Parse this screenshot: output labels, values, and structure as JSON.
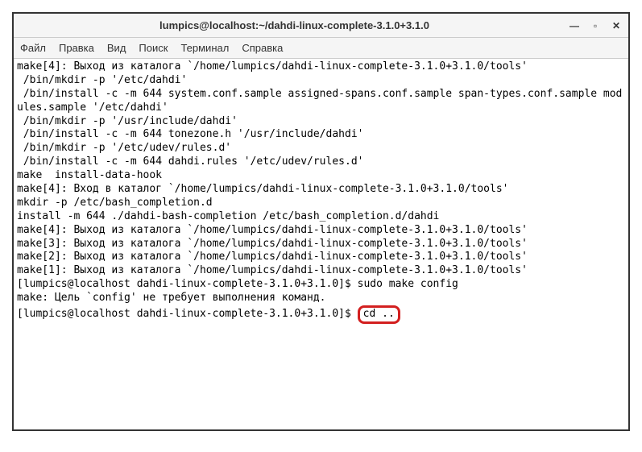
{
  "window": {
    "title": "lumpics@localhost:~/dahdi-linux-complete-3.1.0+3.1.0"
  },
  "menubar": {
    "items": [
      "Файл",
      "Правка",
      "Вид",
      "Поиск",
      "Терминал",
      "Справка"
    ]
  },
  "terminal": {
    "lines": [
      "make[4]: Выход из каталога `/home/lumpics/dahdi-linux-complete-3.1.0+3.1.0/tools'",
      " /bin/mkdir -p '/etc/dahdi'",
      " /bin/install -c -m 644 system.conf.sample assigned-spans.conf.sample span-types.conf.sample modules.sample '/etc/dahdi'",
      " /bin/mkdir -p '/usr/include/dahdi'",
      " /bin/install -c -m 644 tonezone.h '/usr/include/dahdi'",
      " /bin/mkdir -p '/etc/udev/rules.d'",
      " /bin/install -c -m 644 dahdi.rules '/etc/udev/rules.d'",
      "make  install-data-hook",
      "make[4]: Вход в каталог `/home/lumpics/dahdi-linux-complete-3.1.0+3.1.0/tools'",
      "mkdir -p /etc/bash_completion.d",
      "install -m 644 ./dahdi-bash-completion /etc/bash_completion.d/dahdi",
      "make[4]: Выход из каталога `/home/lumpics/dahdi-linux-complete-3.1.0+3.1.0/tools'",
      "make[3]: Выход из каталога `/home/lumpics/dahdi-linux-complete-3.1.0+3.1.0/tools'",
      "make[2]: Выход из каталога `/home/lumpics/dahdi-linux-complete-3.1.0+3.1.0/tools'",
      "make[1]: Выход из каталога `/home/lumpics/dahdi-linux-complete-3.1.0+3.1.0/tools'",
      "[lumpics@localhost dahdi-linux-complete-3.1.0+3.1.0]$ sudo make config",
      "make: Цель `config' не требует выполнения команд."
    ],
    "last_prompt": "[lumpics@localhost dahdi-linux-complete-3.1.0+3.1.0]$ ",
    "highlighted_command": "cd .."
  }
}
